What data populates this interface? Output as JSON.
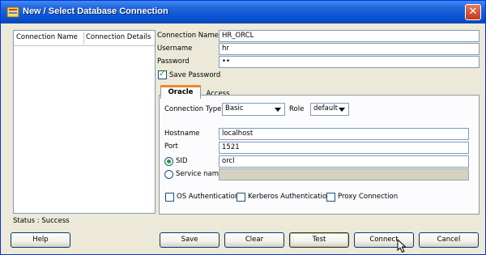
{
  "window": {
    "title": "New / Select Database Connection",
    "close_glyph": "✕"
  },
  "connections": {
    "columns": [
      "Connection Name",
      "Connection Details"
    ]
  },
  "status": "Status : Success",
  "form": {
    "connection_name_label": "Connection Name",
    "connection_name_value": "HR_ORCL",
    "username_label": "Username",
    "username_value": "hr",
    "password_label": "Password",
    "password_value": "••",
    "save_password_label": "Save Password",
    "save_password_checked": true
  },
  "tabs": {
    "active": "Oracle",
    "inactive": "Access"
  },
  "oracle": {
    "connection_type_label": "Connection Type",
    "connection_type_value": "Basic",
    "role_label": "Role",
    "role_value": "default",
    "hostname_label": "Hostname",
    "hostname_value": "localhost",
    "port_label": "Port",
    "port_value": "1521",
    "sid_label": "SID",
    "sid_value": "orcl",
    "service_name_label": "Service name",
    "service_name_value": "",
    "os_auth_label": "OS Authentication",
    "kerberos_label": "Kerberos Authentication",
    "proxy_label": "Proxy Connection"
  },
  "buttons": {
    "help": "Help",
    "save": "Save",
    "clear": "Clear",
    "test": "Test",
    "connect": "Connect",
    "cancel": "Cancel"
  },
  "colors": {
    "titlebar": "#0a55d6",
    "dialog_bg": "#ece9d8",
    "active_tab_accent": "#e68b2c",
    "check_mark": "#21a121"
  }
}
